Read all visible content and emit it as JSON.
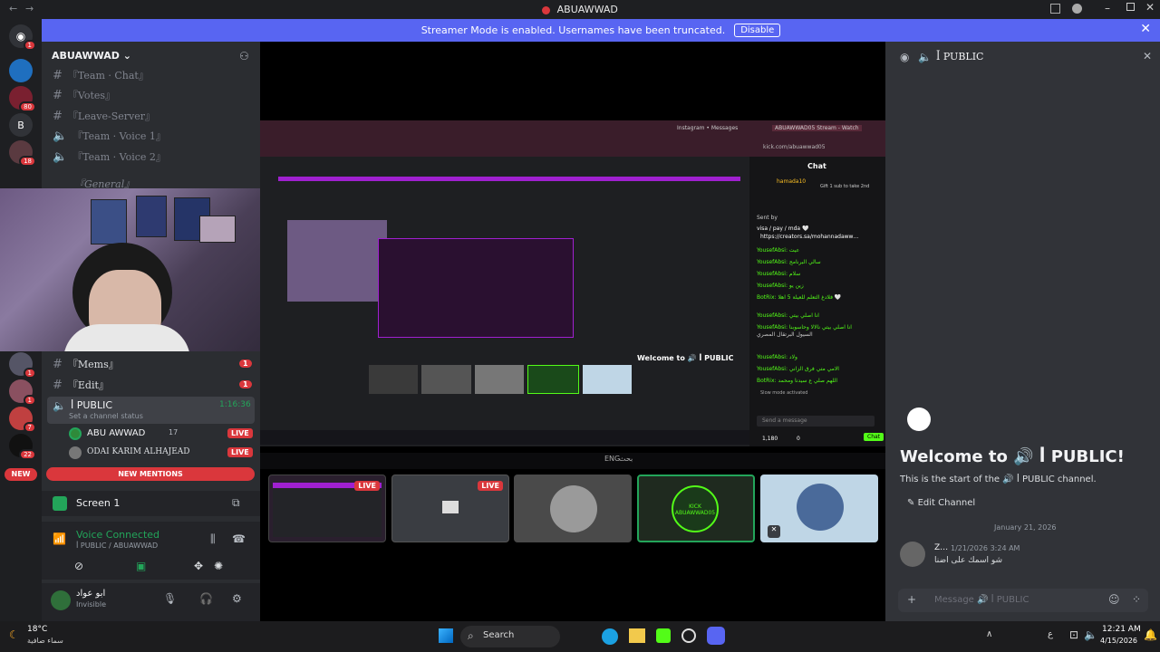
{
  "window": {
    "title": "ABUAWWAD"
  },
  "banner": {
    "text": "Streamer Mode is enabled. Usernames have been truncated.",
    "disable_label": "Disable"
  },
  "rail": {
    "servers": [
      {
        "icon": "discord-icon",
        "badge": "1"
      },
      {
        "icon": "server-icon",
        "badge": ""
      },
      {
        "icon": "server-icon",
        "badge": "80"
      },
      {
        "label": "B",
        "badge": ""
      },
      {
        "icon": "server-icon",
        "badge": "18"
      },
      {
        "icon": "server-icon",
        "badge": "1"
      },
      {
        "icon": "server-icon",
        "badge": "1"
      },
      {
        "icon": "server-icon",
        "badge": "7"
      },
      {
        "icon": "server-icon",
        "badge": "22"
      }
    ],
    "new_label": "NEW"
  },
  "server": {
    "name": "ABUAWWAD"
  },
  "channels_top": [
    {
      "type": "text",
      "name": "『Team · Chat』"
    },
    {
      "type": "text",
      "name": "『Votes』"
    },
    {
      "type": "text",
      "name": "『Leave-Server』"
    },
    {
      "type": "voice",
      "name": "『Team · Voice 1』"
    },
    {
      "type": "voice",
      "name": "『Team · Voice 2』"
    }
  ],
  "category_general": "『General』",
  "channels_bottom": [
    {
      "type": "text",
      "name": "『Mems』",
      "badge": "1"
    },
    {
      "type": "text",
      "name": "『Edit』",
      "badge": "1"
    }
  ],
  "voice_channel": {
    "name": "ꟾ PUBLIC",
    "timer": "1:16:36",
    "status_placeholder": "Set a channel status",
    "members": [
      {
        "name": "ABU AWWAD",
        "extra": "17",
        "live": "LIVE"
      },
      {
        "name": "ODAI KARIM ALHAJEAD",
        "live": "LIVE"
      }
    ]
  },
  "new_mentions": "NEW MENTIONS",
  "screen_panel": {
    "title": "Screen 1"
  },
  "voice_status": {
    "state": "Voice Connected",
    "location": "ꟾ PUBLIC / ABUAWWAD"
  },
  "user": {
    "name": "ابو عواد",
    "status": "Invisible"
  },
  "right_pane": {
    "header": "ꟾ PUBLIC",
    "welcome": "Welcome to 🔊 ꟾ PUBLIC!",
    "start_text": "This is the start of the 🔊 ꟾ PUBLIC channel.",
    "edit_channel": "Edit Channel",
    "date_divider": "January 21, 2026",
    "message": {
      "author": "Z…",
      "time": "1/21/2026 3:24 AM",
      "text": "شو اسمك على اضنا"
    },
    "input_placeholder": "Message 🔊 ꟾ PUBLIC"
  },
  "shared_screen": {
    "tab_label": "Instagram • Messages",
    "tab2_label": "ABUAWWAD05 Stream - Watch",
    "url": "kick.com/abuawwad05",
    "chat_title": "Chat",
    "gift_user": "hamada10",
    "gift_text": "Gift 1 sub to take 2nd",
    "sent_by": "Sent by",
    "pinned": "visa / pay / mda 🤍",
    "pinned_link": "https://creators.sa/mohannadaww…",
    "chat_lines": [
      "YousefAbsi: عيت",
      "YousefAbsi: سالي البرنامج",
      "YousefAbsi: سلام",
      "YousefAbsi: زين يو",
      "BotRix: فلادغ التعلم للعيلة 5 اهلا 🤍",
      "YousefAbsi: انا اصلي بيتي",
      "YousefAbsi: انا اصلي بيتي نالالا وحاسوبنا",
      "السيول البرتقال المصري",
      "YousefAbsi: ولاد",
      "YousefAbsi: الامي متي فرق الزاني",
      "BotRix: اللهم صلي ع سيدنا ومحمد"
    ],
    "slow_mode": "Slow mode activated",
    "send_placeholder": "Send a message",
    "points": "1,180",
    "points2": "0",
    "chat_button": "Chat",
    "inner_welcome": "Welcome to 🔊 ꟾ PUBLIC",
    "search_text": "بحث",
    "lang": "ENG"
  },
  "tiles": [
    {
      "type": "screen",
      "live": "LIVE"
    },
    {
      "type": "screen",
      "live": "LIVE"
    },
    {
      "type": "avatar"
    },
    {
      "type": "kick-logo",
      "label": "KICK ABUAWWAD05"
    },
    {
      "type": "avatar-car"
    }
  ],
  "taskbar": {
    "weather_temp": "18°C",
    "weather_desc": "سماء صافية",
    "search": "Search",
    "lang": "ع",
    "time": "12:21 AM",
    "date": "4/15/2026"
  },
  "colors": {
    "blurple": "#5865f2",
    "red": "#da373c",
    "green": "#23a55a",
    "kick": "#53fc18"
  }
}
